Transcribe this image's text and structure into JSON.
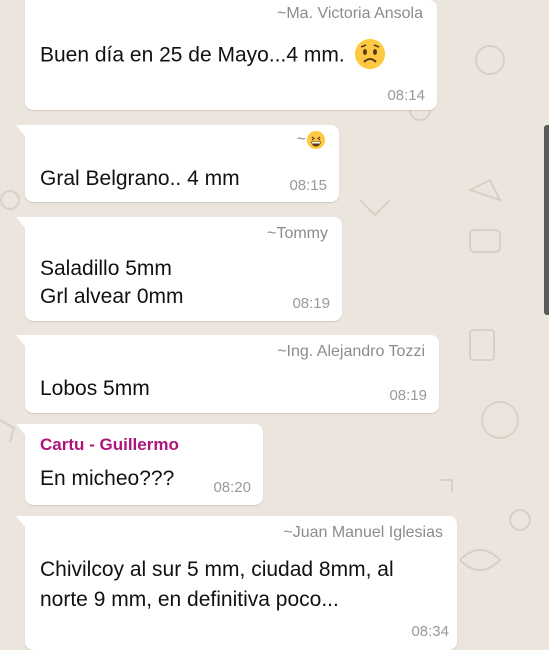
{
  "colors": {
    "chat_background": "#ece5dd",
    "bubble": "#ffffff",
    "sender_name": "#8c8c8c",
    "highlighted_sender": "#b0147a",
    "timestamp": "#9a9a9a"
  },
  "messages": [
    {
      "sender": "~Ma. Victoria Ansola",
      "text": "Buen día en 25 de Mayo...4 mm.",
      "emoji": "worried-face-icon",
      "time": "08:14"
    },
    {
      "sender": "~",
      "sender_emoji": "grinning-face-icon",
      "text": "Gral Belgrano.. 4 mm",
      "time": "08:15"
    },
    {
      "sender": "~Tommy",
      "lines": [
        "Saladillo 5mm",
        "Grl alvear 0mm"
      ],
      "time": "08:19"
    },
    {
      "sender": "~Ing. Alejandro Tozzi",
      "text": "Lobos 5mm",
      "time": "08:19"
    },
    {
      "sender": "Cartu - Guillermo",
      "text": "En micheo???",
      "time": "08:20"
    },
    {
      "sender": "~Juan Manuel Iglesias",
      "lines": [
        "Chivilcoy al sur 5 mm, ciudad 8mm, al",
        "norte 9 mm, en definitiva poco..."
      ],
      "time": "08:34"
    }
  ]
}
